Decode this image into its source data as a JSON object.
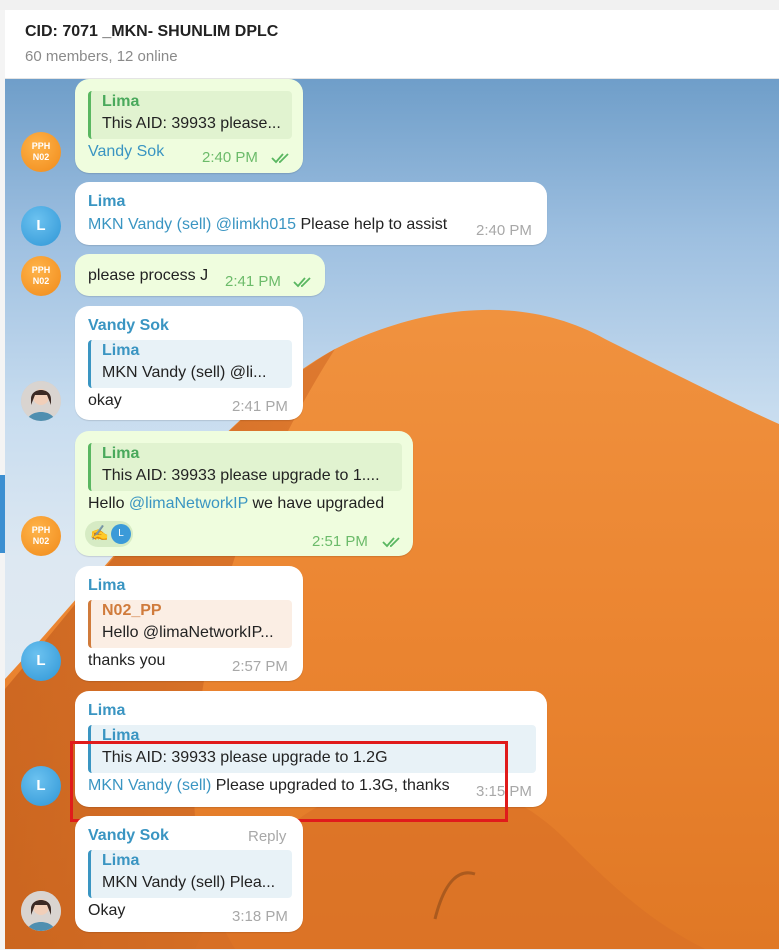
{
  "header": {
    "title": "CID: 7071 _MKN- SHUNLIM DPLC",
    "subtitle": "60 members, 12 online"
  },
  "avatars": {
    "pph_line1": "PPH",
    "pph_line2": "N02",
    "lima_initial": "L"
  },
  "messages": [
    {
      "reply_name": "Lima",
      "reply_text": "This AID: 39933 please...",
      "text_link": "Vandy Sok",
      "time": "2:40 PM"
    },
    {
      "sender": "Lima",
      "link1": "MKN Vandy (sell)",
      "link2": "@limkh015",
      "text": " Please help to assist",
      "time": "2:40 PM"
    },
    {
      "text": "please process J",
      "time": "2:41 PM"
    },
    {
      "sender": "Vandy Sok",
      "reply_name": "Lima",
      "reply_text": "MKN Vandy (sell)  @li...",
      "text": "okay",
      "time": "2:41 PM"
    },
    {
      "reply_name": "Lima",
      "reply_text": "This AID: 39933 please upgrade to 1....",
      "text_pre": "Hello ",
      "text_link": "@limaNetworkIP",
      "text_post": " we have upgraded",
      "reaction_emoji": "✍️",
      "time": "2:51 PM"
    },
    {
      "sender": "Lima",
      "reply_name": "N02_PP",
      "reply_text": "Hello @limaNetworkIP...",
      "text": "thanks you",
      "time": "2:57 PM"
    },
    {
      "sender": "Lima",
      "reply_name": "Lima",
      "reply_text": "This AID: 39933 please upgrade to 1.2G",
      "text_link": "MKN Vandy (sell)",
      "text_post": " Please upgraded to 1.3G, thanks",
      "time": "3:15 PM"
    },
    {
      "sender": "Vandy Sok",
      "reply_label": "Reply",
      "reply_name": "Lima",
      "reply_text": "MKN Vandy (sell) Plea...",
      "text": "Okay",
      "time": "3:18 PM"
    }
  ],
  "colors": {
    "outgoing_bubble": "#effdde",
    "incoming_bubble": "#ffffff",
    "link": "#3a95c2",
    "highlight_box": "#e01b1b"
  }
}
